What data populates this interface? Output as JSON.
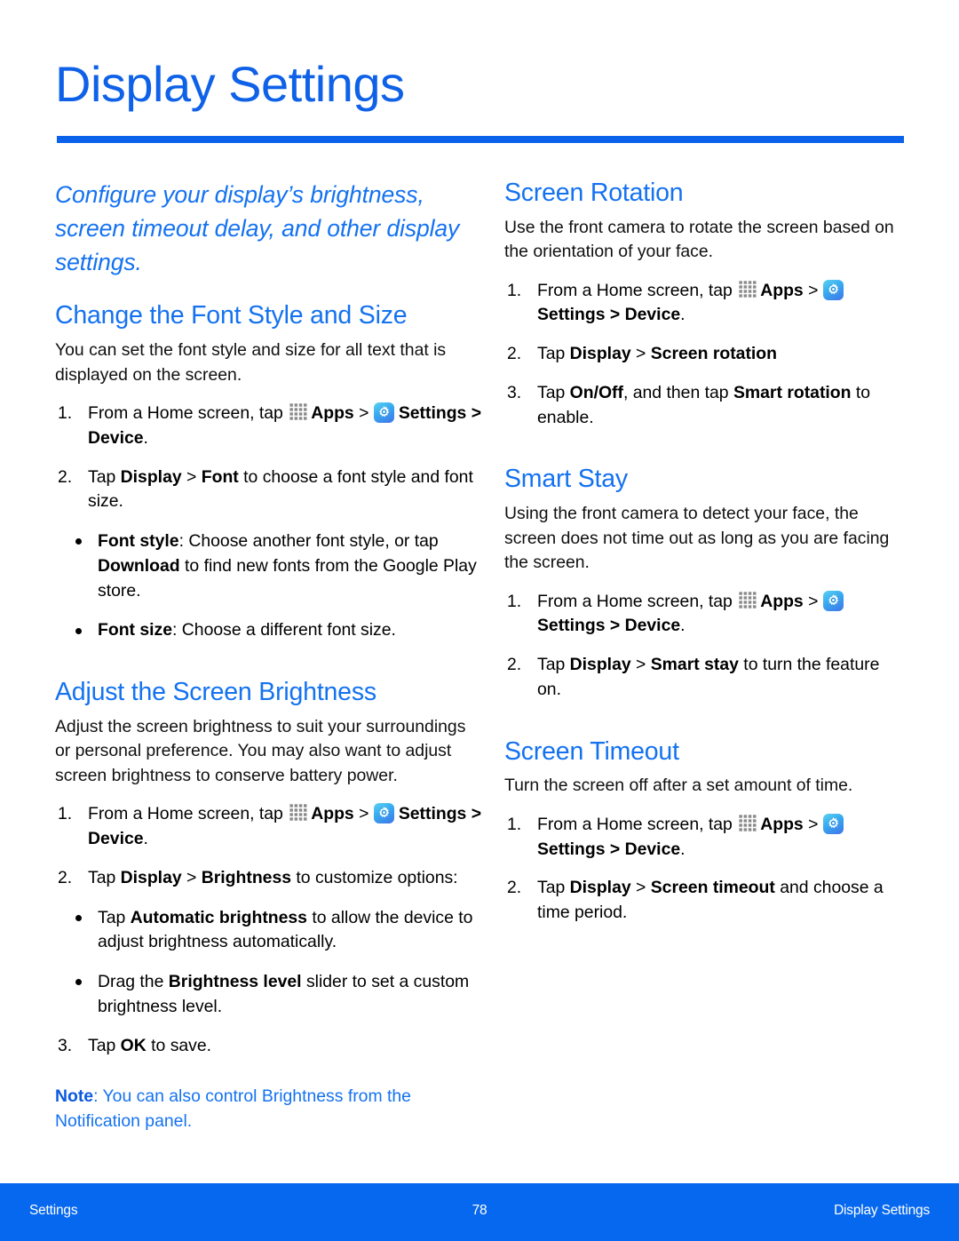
{
  "page": {
    "title": "Display Settings",
    "accent_color": "#1472f0",
    "rule_color": "#0b62ea",
    "footer_color": "#0668ee"
  },
  "icons": {
    "apps": "apps-grid-icon",
    "settings": "settings-gear-icon"
  },
  "left_column": {
    "intro": "Configure your display’s brightness, screen timeout delay, and other display settings.",
    "sections": [
      {
        "heading": "Change the Font Style and Size",
        "body": "You can set the font style and size for all text that is displayed on the screen.",
        "steps": [
          {
            "num": "1.",
            "parts": [
              {
                "t": "text",
                "v": "From a Home screen, tap "
              },
              {
                "t": "icon",
                "v": "apps"
              },
              {
                "t": "bold",
                "v": "Apps"
              },
              {
                "t": "text",
                "v": " > "
              },
              {
                "t": "icon",
                "v": "settings"
              },
              {
                "t": "bold",
                "v": "Settings"
              },
              {
                "t": "bold",
                "v": " > "
              },
              {
                "t": "bold",
                "v": "Device"
              },
              {
                "t": "text",
                "v": "."
              }
            ]
          },
          {
            "num": "2.",
            "parts": [
              {
                "t": "text",
                "v": "Tap "
              },
              {
                "t": "bold",
                "v": "Display"
              },
              {
                "t": "text",
                "v": " > "
              },
              {
                "t": "bold",
                "v": "Font"
              },
              {
                "t": "text",
                "v": " to choose a font style and font size."
              }
            ]
          }
        ],
        "bullets": [
          [
            {
              "t": "bold",
              "v": "Font style"
            },
            {
              "t": "text",
              "v": ": Choose another font style, or tap "
            },
            {
              "t": "bold",
              "v": "Download"
            },
            {
              "t": "text",
              "v": " to find new fonts from the Google Play store."
            }
          ],
          [
            {
              "t": "bold",
              "v": "Font size"
            },
            {
              "t": "text",
              "v": ": Choose a different font size."
            }
          ]
        ]
      },
      {
        "heading": "Adjust the Screen Brightness",
        "body": "Adjust the screen brightness to suit your surroundings or personal preference. You may also want to adjust screen brightness to conserve battery power.",
        "steps": [
          {
            "num": "1.",
            "parts": [
              {
                "t": "text",
                "v": "From a Home screen, tap "
              },
              {
                "t": "icon",
                "v": "apps"
              },
              {
                "t": "bold",
                "v": "Apps"
              },
              {
                "t": "text",
                "v": " > "
              },
              {
                "t": "icon",
                "v": "settings"
              },
              {
                "t": "bold",
                "v": "Settings"
              },
              {
                "t": "bold",
                "v": " > "
              },
              {
                "t": "bold",
                "v": "Device"
              },
              {
                "t": "text",
                "v": "."
              }
            ]
          },
          {
            "num": "2.",
            "parts": [
              {
                "t": "text",
                "v": "Tap "
              },
              {
                "t": "bold",
                "v": "Display"
              },
              {
                "t": "text",
                "v": " > "
              },
              {
                "t": "bold",
                "v": "Brightness"
              },
              {
                "t": "text",
                "v": " to customize options:"
              }
            ]
          }
        ],
        "bullets": [
          [
            {
              "t": "text",
              "v": "Tap "
            },
            {
              "t": "bold",
              "v": "Automatic brightness"
            },
            {
              "t": "text",
              "v": " to allow the device to adjust brightness automatically."
            }
          ],
          [
            {
              "t": "text",
              "v": "Drag the "
            },
            {
              "t": "bold",
              "v": "Brightness level"
            },
            {
              "t": "text",
              "v": " slider to set a custom brightness level."
            }
          ]
        ],
        "steps_after": [
          {
            "num": "3.",
            "parts": [
              {
                "t": "text",
                "v": "Tap "
              },
              {
                "t": "bold",
                "v": "OK"
              },
              {
                "t": "text",
                "v": " to save."
              }
            ]
          }
        ],
        "note": {
          "label": "Note",
          "text": ": You can also control Brightness from the Notification panel."
        }
      }
    ]
  },
  "right_column": {
    "sections": [
      {
        "heading": "Screen Rotation",
        "body": "Use the front camera to rotate the screen based on the orientation of your face.",
        "steps": [
          {
            "num": "1.",
            "parts": [
              {
                "t": "text",
                "v": "From a Home screen, tap "
              },
              {
                "t": "icon",
                "v": "apps"
              },
              {
                "t": "bold",
                "v": "Apps"
              },
              {
                "t": "text",
                "v": " > "
              },
              {
                "t": "icon",
                "v": "settings"
              },
              {
                "t": "bold",
                "v": "Settings"
              },
              {
                "t": "bold",
                "v": " > "
              },
              {
                "t": "bold",
                "v": "Device"
              },
              {
                "t": "text",
                "v": "."
              }
            ]
          },
          {
            "num": "2.",
            "parts": [
              {
                "t": "text",
                "v": "Tap "
              },
              {
                "t": "bold",
                "v": "Display"
              },
              {
                "t": "text",
                "v": " > "
              },
              {
                "t": "bold",
                "v": "Screen rotation"
              }
            ]
          },
          {
            "num": "3.",
            "parts": [
              {
                "t": "text",
                "v": "Tap "
              },
              {
                "t": "bold",
                "v": "On/Off"
              },
              {
                "t": "text",
                "v": ", and then tap "
              },
              {
                "t": "bold",
                "v": "Smart rotation"
              },
              {
                "t": "text",
                "v": " to enable."
              }
            ]
          }
        ]
      },
      {
        "heading": "Smart Stay",
        "body": "Using the front camera to detect your face, the screen does not time out as long as you are facing the screen.",
        "steps": [
          {
            "num": "1.",
            "parts": [
              {
                "t": "text",
                "v": "From a Home screen, tap "
              },
              {
                "t": "icon",
                "v": "apps"
              },
              {
                "t": "bold",
                "v": "Apps"
              },
              {
                "t": "text",
                "v": " > "
              },
              {
                "t": "icon",
                "v": "settings"
              },
              {
                "t": "bold",
                "v": "Settings"
              },
              {
                "t": "bold",
                "v": " > "
              },
              {
                "t": "bold",
                "v": "Device"
              },
              {
                "t": "text",
                "v": "."
              }
            ]
          },
          {
            "num": "2.",
            "parts": [
              {
                "t": "text",
                "v": "Tap "
              },
              {
                "t": "bold",
                "v": "Display"
              },
              {
                "t": "text",
                "v": " > "
              },
              {
                "t": "bold",
                "v": "Smart stay"
              },
              {
                "t": "text",
                "v": " to turn the feature on."
              }
            ]
          }
        ]
      },
      {
        "heading": "Screen Timeout",
        "body": "Turn the screen off after a set amount of time.",
        "steps": [
          {
            "num": "1.",
            "parts": [
              {
                "t": "text",
                "v": "From a Home screen, tap "
              },
              {
                "t": "icon",
                "v": "apps"
              },
              {
                "t": "bold",
                "v": "Apps"
              },
              {
                "t": "text",
                "v": " > "
              },
              {
                "t": "icon",
                "v": "settings"
              },
              {
                "t": "bold",
                "v": "Settings"
              },
              {
                "t": "bold",
                "v": " > "
              },
              {
                "t": "bold",
                "v": "Device"
              },
              {
                "t": "text",
                "v": "."
              }
            ]
          },
          {
            "num": "2.",
            "parts": [
              {
                "t": "text",
                "v": "Tap "
              },
              {
                "t": "bold",
                "v": "Display"
              },
              {
                "t": "text",
                "v": " > "
              },
              {
                "t": "bold",
                "v": "Screen timeout"
              },
              {
                "t": "text",
                "v": " and choose a time period."
              }
            ]
          }
        ]
      }
    ]
  },
  "footer": {
    "left": "Settings",
    "page_number": "78",
    "right": "Display Settings"
  }
}
